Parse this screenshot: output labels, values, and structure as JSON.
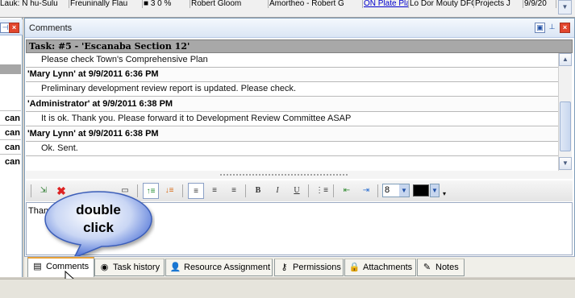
{
  "top_strip": {
    "cells": [
      "Lauk: N hu-Sulu",
      "Freuninally Flau",
      "■ 3 0 %",
      "Robert Gloom",
      "Amortheo - Robert G",
      "ON Plate Plan",
      "Lo Dor Mouty DFG",
      "Projects J",
      "9/9/20"
    ],
    "link_cell": "ON Plate Plan"
  },
  "left_panel": {
    "rows": [
      "can",
      "can",
      "can",
      "can"
    ]
  },
  "comments": {
    "title": "Comments",
    "task_title": "Task: #5 - 'Escanaba Section 12'",
    "entries": [
      {
        "type": "msg",
        "text": "Please check Town's Comprehensive Plan"
      },
      {
        "type": "hdr",
        "text": "'Mary Lynn' at 9/9/2011 6:36 PM"
      },
      {
        "type": "msg",
        "text": "Preliminary development review report is updated. Please check."
      },
      {
        "type": "hdr",
        "text": "'Administrator' at 9/9/2011 6:38 PM"
      },
      {
        "type": "msg",
        "text": "It is ok. Thank you. Please forward it to Development Review Committee ASAP"
      },
      {
        "type": "hdr",
        "text": "'Mary Lynn' at 9/9/2011 6:38 PM"
      },
      {
        "type": "msg",
        "text": "Ok. Sent."
      }
    ]
  },
  "toolbar": {
    "font_size": "8",
    "text_color": "#000000",
    "buttons": [
      "insert-icon",
      "delete-icon",
      "toggle-icon",
      "sort-asc-icon",
      "sort-desc-icon",
      "align-left-icon",
      "align-center-icon",
      "align-right-icon",
      "bold-icon",
      "italic-icon",
      "underline-icon",
      "bullets-icon",
      "outdent-icon",
      "indent-icon"
    ],
    "bold_label": "B",
    "italic_label": "I",
    "underline_label": "U"
  },
  "editor": {
    "text": "Than"
  },
  "callout": {
    "line1": "double",
    "line2": "click"
  },
  "tabs": [
    {
      "label": "Comments",
      "icon": "comments-icon",
      "active": true
    },
    {
      "label": "Task history",
      "icon": "history-icon",
      "active": false
    },
    {
      "label": "Resource Assignment",
      "icon": "resource-icon",
      "active": false
    },
    {
      "label": "Permissions",
      "icon": "key-icon",
      "active": false
    },
    {
      "label": "Attachments",
      "icon": "lock-icon",
      "active": false
    },
    {
      "label": "Notes",
      "icon": "notes-icon",
      "active": false
    }
  ],
  "colors": {
    "header_blue": "#dbe6f5",
    "task_bar": "#a8a8a8",
    "close_red": "#e2462d",
    "callout_fill": "#4a6fd6"
  }
}
